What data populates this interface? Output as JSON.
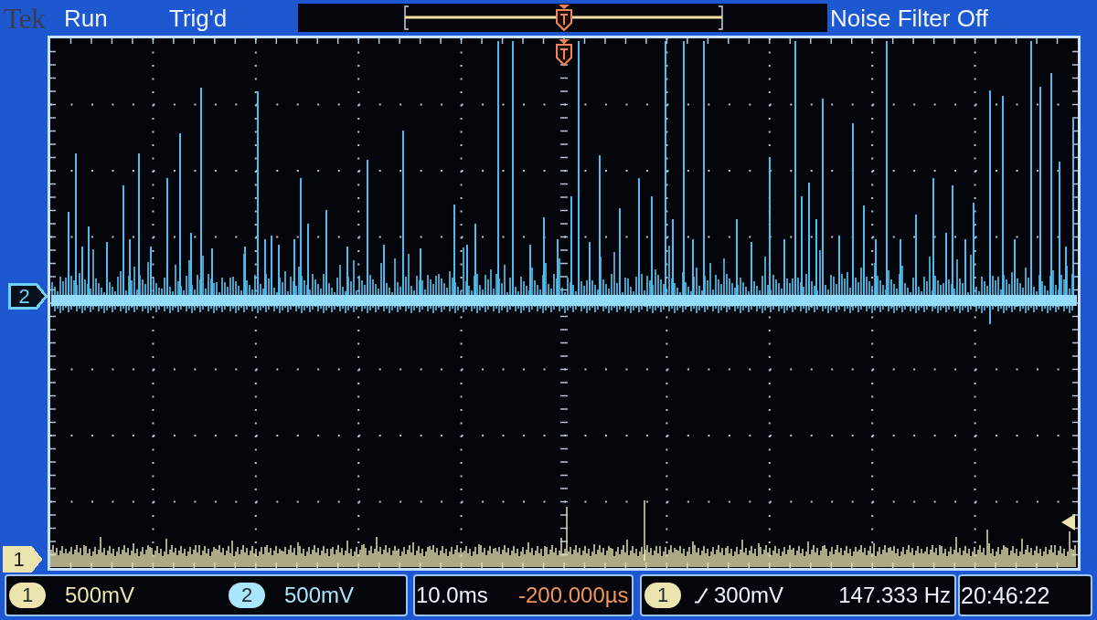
{
  "top_bar": {
    "logo": "Tek",
    "run_state": "Run",
    "trigger_status": "Trig'd",
    "noise_filter": "Noise Filter Off"
  },
  "display": {
    "channel_markers": [
      {
        "label": "2",
        "filled": false,
        "color": "#6fd3f7"
      },
      {
        "label": "1",
        "filled": true,
        "color": "#ece4ae"
      }
    ]
  },
  "bottom_bar": {
    "channels": [
      {
        "label": "1",
        "scale": "500mV",
        "color": "#ece4ae"
      },
      {
        "label": "2",
        "scale": "500mV",
        "color": "#a9e6fb"
      }
    ],
    "timebase": {
      "scale": "10.0ms",
      "position": "-200.000µs"
    },
    "trigger": {
      "source": "1",
      "level": "300mV",
      "frequency": "147.333 Hz"
    },
    "clock": "20:46:22"
  }
}
